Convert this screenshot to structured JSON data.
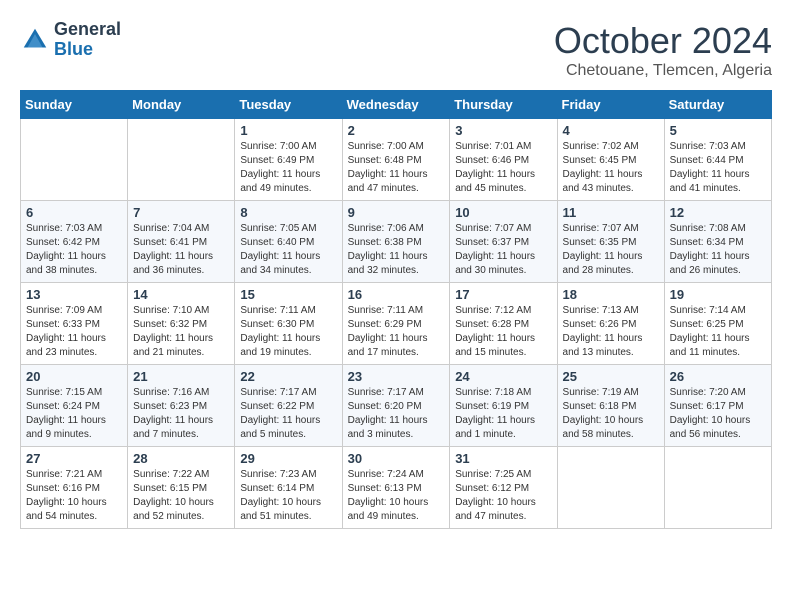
{
  "logo": {
    "line1": "General",
    "line2": "Blue"
  },
  "title": "October 2024",
  "location": "Chetouane, Tlemcen, Algeria",
  "days_of_week": [
    "Sunday",
    "Monday",
    "Tuesday",
    "Wednesday",
    "Thursday",
    "Friday",
    "Saturday"
  ],
  "weeks": [
    [
      null,
      null,
      {
        "day": "1",
        "sunrise": "7:00 AM",
        "sunset": "6:49 PM",
        "daylight": "11 hours and 49 minutes."
      },
      {
        "day": "2",
        "sunrise": "7:00 AM",
        "sunset": "6:48 PM",
        "daylight": "11 hours and 47 minutes."
      },
      {
        "day": "3",
        "sunrise": "7:01 AM",
        "sunset": "6:46 PM",
        "daylight": "11 hours and 45 minutes."
      },
      {
        "day": "4",
        "sunrise": "7:02 AM",
        "sunset": "6:45 PM",
        "daylight": "11 hours and 43 minutes."
      },
      {
        "day": "5",
        "sunrise": "7:03 AM",
        "sunset": "6:44 PM",
        "daylight": "11 hours and 41 minutes."
      }
    ],
    [
      {
        "day": "6",
        "sunrise": "7:03 AM",
        "sunset": "6:42 PM",
        "daylight": "11 hours and 38 minutes."
      },
      {
        "day": "7",
        "sunrise": "7:04 AM",
        "sunset": "6:41 PM",
        "daylight": "11 hours and 36 minutes."
      },
      {
        "day": "8",
        "sunrise": "7:05 AM",
        "sunset": "6:40 PM",
        "daylight": "11 hours and 34 minutes."
      },
      {
        "day": "9",
        "sunrise": "7:06 AM",
        "sunset": "6:38 PM",
        "daylight": "11 hours and 32 minutes."
      },
      {
        "day": "10",
        "sunrise": "7:07 AM",
        "sunset": "6:37 PM",
        "daylight": "11 hours and 30 minutes."
      },
      {
        "day": "11",
        "sunrise": "7:07 AM",
        "sunset": "6:35 PM",
        "daylight": "11 hours and 28 minutes."
      },
      {
        "day": "12",
        "sunrise": "7:08 AM",
        "sunset": "6:34 PM",
        "daylight": "11 hours and 26 minutes."
      }
    ],
    [
      {
        "day": "13",
        "sunrise": "7:09 AM",
        "sunset": "6:33 PM",
        "daylight": "11 hours and 23 minutes."
      },
      {
        "day": "14",
        "sunrise": "7:10 AM",
        "sunset": "6:32 PM",
        "daylight": "11 hours and 21 minutes."
      },
      {
        "day": "15",
        "sunrise": "7:11 AM",
        "sunset": "6:30 PM",
        "daylight": "11 hours and 19 minutes."
      },
      {
        "day": "16",
        "sunrise": "7:11 AM",
        "sunset": "6:29 PM",
        "daylight": "11 hours and 17 minutes."
      },
      {
        "day": "17",
        "sunrise": "7:12 AM",
        "sunset": "6:28 PM",
        "daylight": "11 hours and 15 minutes."
      },
      {
        "day": "18",
        "sunrise": "7:13 AM",
        "sunset": "6:26 PM",
        "daylight": "11 hours and 13 minutes."
      },
      {
        "day": "19",
        "sunrise": "7:14 AM",
        "sunset": "6:25 PM",
        "daylight": "11 hours and 11 minutes."
      }
    ],
    [
      {
        "day": "20",
        "sunrise": "7:15 AM",
        "sunset": "6:24 PM",
        "daylight": "11 hours and 9 minutes."
      },
      {
        "day": "21",
        "sunrise": "7:16 AM",
        "sunset": "6:23 PM",
        "daylight": "11 hours and 7 minutes."
      },
      {
        "day": "22",
        "sunrise": "7:17 AM",
        "sunset": "6:22 PM",
        "daylight": "11 hours and 5 minutes."
      },
      {
        "day": "23",
        "sunrise": "7:17 AM",
        "sunset": "6:20 PM",
        "daylight": "11 hours and 3 minutes."
      },
      {
        "day": "24",
        "sunrise": "7:18 AM",
        "sunset": "6:19 PM",
        "daylight": "11 hours and 1 minute."
      },
      {
        "day": "25",
        "sunrise": "7:19 AM",
        "sunset": "6:18 PM",
        "daylight": "10 hours and 58 minutes."
      },
      {
        "day": "26",
        "sunrise": "7:20 AM",
        "sunset": "6:17 PM",
        "daylight": "10 hours and 56 minutes."
      }
    ],
    [
      {
        "day": "27",
        "sunrise": "7:21 AM",
        "sunset": "6:16 PM",
        "daylight": "10 hours and 54 minutes."
      },
      {
        "day": "28",
        "sunrise": "7:22 AM",
        "sunset": "6:15 PM",
        "daylight": "10 hours and 52 minutes."
      },
      {
        "day": "29",
        "sunrise": "7:23 AM",
        "sunset": "6:14 PM",
        "daylight": "10 hours and 51 minutes."
      },
      {
        "day": "30",
        "sunrise": "7:24 AM",
        "sunset": "6:13 PM",
        "daylight": "10 hours and 49 minutes."
      },
      {
        "day": "31",
        "sunrise": "7:25 AM",
        "sunset": "6:12 PM",
        "daylight": "10 hours and 47 minutes."
      },
      null,
      null
    ]
  ]
}
